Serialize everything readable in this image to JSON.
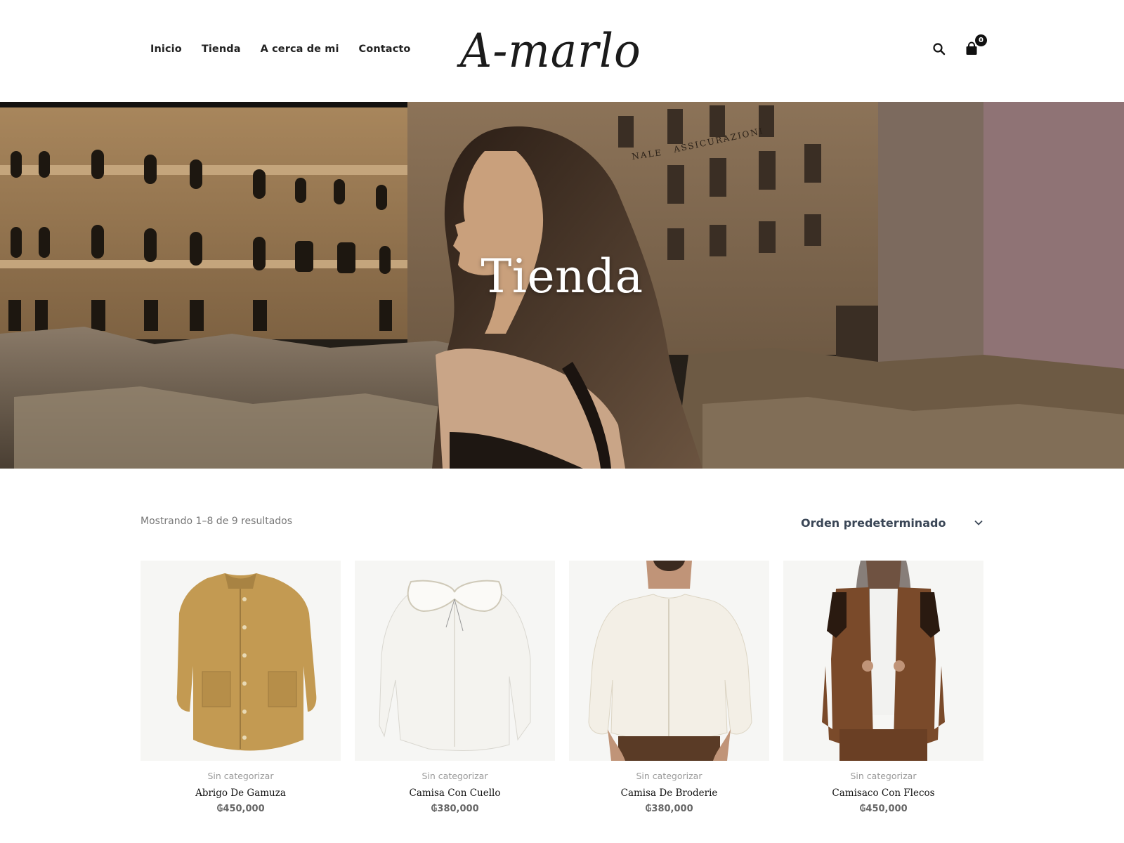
{
  "brand": {
    "logo_text": "A-marlo"
  },
  "nav": [
    {
      "label": "Inicio"
    },
    {
      "label": "Tienda"
    },
    {
      "label": "A cerca de mi"
    },
    {
      "label": "Contacto"
    }
  ],
  "header_icons": {
    "search": "search-icon",
    "cart": "shopping-bag-icon",
    "cart_count": "0"
  },
  "hero": {
    "title": "Tienda"
  },
  "shop": {
    "results_text": "Mostrando 1–8 de 9 resultados",
    "sort_selected": "Orden predeterminado"
  },
  "products": [
    {
      "category": "Sin categorizar",
      "name": "Abrigo De Gamuza",
      "price": "₲450,000"
    },
    {
      "category": "Sin categorizar",
      "name": "Camisa Con Cuello",
      "price": "₲380,000"
    },
    {
      "category": "Sin categorizar",
      "name": "Camisa De Broderie",
      "price": "₲380,000"
    },
    {
      "category": "Sin categorizar",
      "name": "Camisaco Con Flecos",
      "price": "₲450,000"
    }
  ],
  "colors": {
    "text": "#1a1a1a",
    "muted": "#777777",
    "sort_text": "#3a4656",
    "badge": "#111111"
  }
}
